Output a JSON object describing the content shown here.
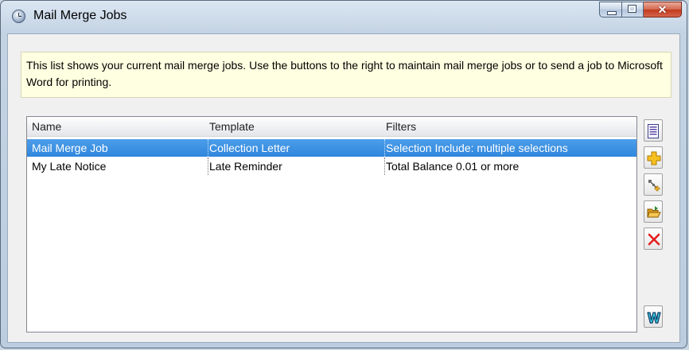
{
  "window": {
    "title": "Mail Merge Jobs"
  },
  "info": {
    "text": "This list shows your current mail merge jobs. Use the buttons to the right to maintain mail merge jobs or to send a job to Microsoft Word for printing."
  },
  "list": {
    "columns": [
      "Name",
      "Template",
      "Filters"
    ],
    "rows": [
      {
        "name": "Mail Merge Job",
        "template": "Collection Letter",
        "filters": "Selection Include: multiple selections",
        "selected": true
      },
      {
        "name": "My Late Notice",
        "template": "Late Reminder",
        "filters": "Total Balance 0.01 or more",
        "selected": false
      }
    ]
  },
  "toolbar": {
    "icons": [
      "list-icon",
      "add-icon",
      "copy-icon",
      "open-folder-icon",
      "delete-icon",
      "word-icon"
    ]
  },
  "colors": {
    "selection": "#3391e2",
    "info_background": "#ffffe1",
    "delete": "#e41e1e"
  }
}
